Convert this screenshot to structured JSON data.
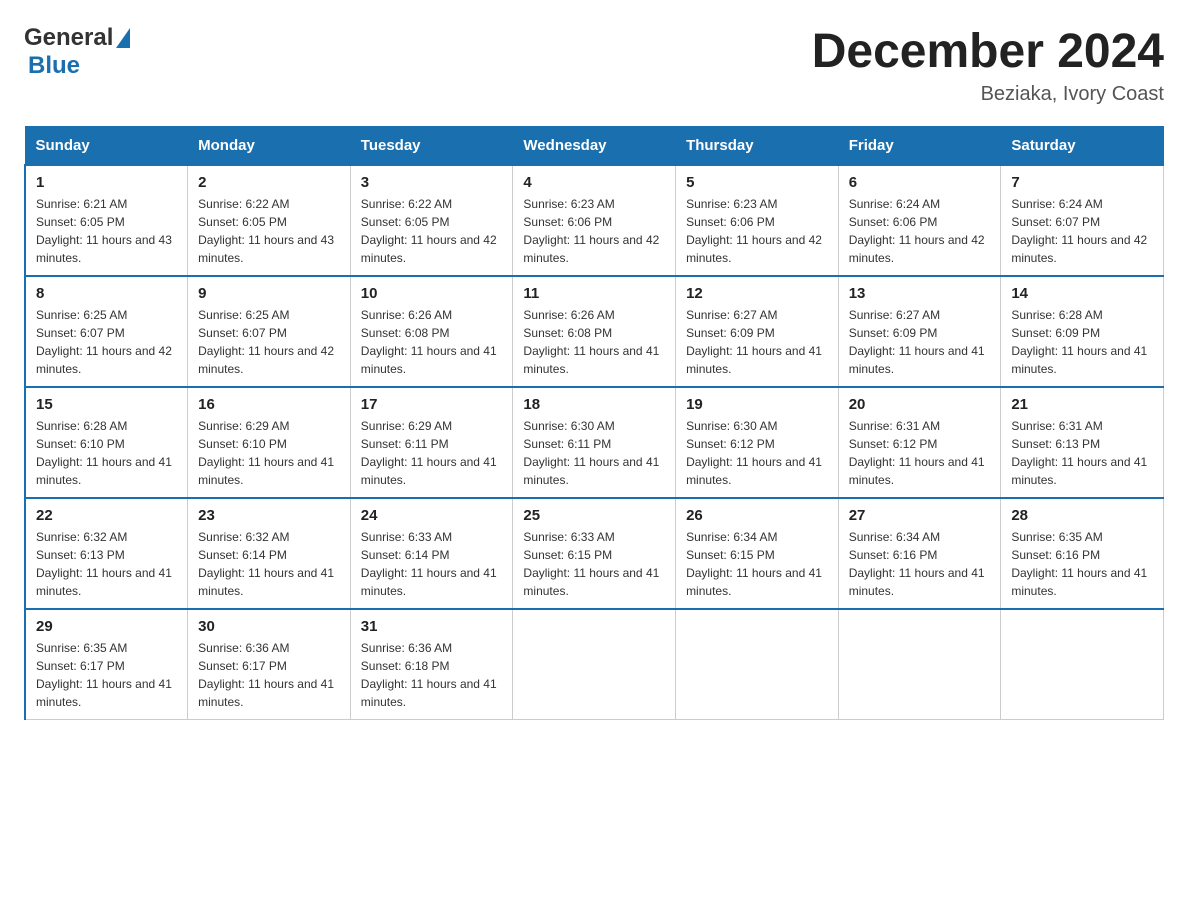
{
  "header": {
    "logo_general": "General",
    "logo_blue": "Blue",
    "month_title": "December 2024",
    "location": "Beziaka, Ivory Coast"
  },
  "days_of_week": [
    "Sunday",
    "Monday",
    "Tuesday",
    "Wednesday",
    "Thursday",
    "Friday",
    "Saturday"
  ],
  "weeks": [
    [
      {
        "day": "1",
        "sunrise": "6:21 AM",
        "sunset": "6:05 PM",
        "daylight": "11 hours and 43 minutes."
      },
      {
        "day": "2",
        "sunrise": "6:22 AM",
        "sunset": "6:05 PM",
        "daylight": "11 hours and 43 minutes."
      },
      {
        "day": "3",
        "sunrise": "6:22 AM",
        "sunset": "6:05 PM",
        "daylight": "11 hours and 42 minutes."
      },
      {
        "day": "4",
        "sunrise": "6:23 AM",
        "sunset": "6:06 PM",
        "daylight": "11 hours and 42 minutes."
      },
      {
        "day": "5",
        "sunrise": "6:23 AM",
        "sunset": "6:06 PM",
        "daylight": "11 hours and 42 minutes."
      },
      {
        "day": "6",
        "sunrise": "6:24 AM",
        "sunset": "6:06 PM",
        "daylight": "11 hours and 42 minutes."
      },
      {
        "day": "7",
        "sunrise": "6:24 AM",
        "sunset": "6:07 PM",
        "daylight": "11 hours and 42 minutes."
      }
    ],
    [
      {
        "day": "8",
        "sunrise": "6:25 AM",
        "sunset": "6:07 PM",
        "daylight": "11 hours and 42 minutes."
      },
      {
        "day": "9",
        "sunrise": "6:25 AM",
        "sunset": "6:07 PM",
        "daylight": "11 hours and 42 minutes."
      },
      {
        "day": "10",
        "sunrise": "6:26 AM",
        "sunset": "6:08 PM",
        "daylight": "11 hours and 41 minutes."
      },
      {
        "day": "11",
        "sunrise": "6:26 AM",
        "sunset": "6:08 PM",
        "daylight": "11 hours and 41 minutes."
      },
      {
        "day": "12",
        "sunrise": "6:27 AM",
        "sunset": "6:09 PM",
        "daylight": "11 hours and 41 minutes."
      },
      {
        "day": "13",
        "sunrise": "6:27 AM",
        "sunset": "6:09 PM",
        "daylight": "11 hours and 41 minutes."
      },
      {
        "day": "14",
        "sunrise": "6:28 AM",
        "sunset": "6:09 PM",
        "daylight": "11 hours and 41 minutes."
      }
    ],
    [
      {
        "day": "15",
        "sunrise": "6:28 AM",
        "sunset": "6:10 PM",
        "daylight": "11 hours and 41 minutes."
      },
      {
        "day": "16",
        "sunrise": "6:29 AM",
        "sunset": "6:10 PM",
        "daylight": "11 hours and 41 minutes."
      },
      {
        "day": "17",
        "sunrise": "6:29 AM",
        "sunset": "6:11 PM",
        "daylight": "11 hours and 41 minutes."
      },
      {
        "day": "18",
        "sunrise": "6:30 AM",
        "sunset": "6:11 PM",
        "daylight": "11 hours and 41 minutes."
      },
      {
        "day": "19",
        "sunrise": "6:30 AM",
        "sunset": "6:12 PM",
        "daylight": "11 hours and 41 minutes."
      },
      {
        "day": "20",
        "sunrise": "6:31 AM",
        "sunset": "6:12 PM",
        "daylight": "11 hours and 41 minutes."
      },
      {
        "day": "21",
        "sunrise": "6:31 AM",
        "sunset": "6:13 PM",
        "daylight": "11 hours and 41 minutes."
      }
    ],
    [
      {
        "day": "22",
        "sunrise": "6:32 AM",
        "sunset": "6:13 PM",
        "daylight": "11 hours and 41 minutes."
      },
      {
        "day": "23",
        "sunrise": "6:32 AM",
        "sunset": "6:14 PM",
        "daylight": "11 hours and 41 minutes."
      },
      {
        "day": "24",
        "sunrise": "6:33 AM",
        "sunset": "6:14 PM",
        "daylight": "11 hours and 41 minutes."
      },
      {
        "day": "25",
        "sunrise": "6:33 AM",
        "sunset": "6:15 PM",
        "daylight": "11 hours and 41 minutes."
      },
      {
        "day": "26",
        "sunrise": "6:34 AM",
        "sunset": "6:15 PM",
        "daylight": "11 hours and 41 minutes."
      },
      {
        "day": "27",
        "sunrise": "6:34 AM",
        "sunset": "6:16 PM",
        "daylight": "11 hours and 41 minutes."
      },
      {
        "day": "28",
        "sunrise": "6:35 AM",
        "sunset": "6:16 PM",
        "daylight": "11 hours and 41 minutes."
      }
    ],
    [
      {
        "day": "29",
        "sunrise": "6:35 AM",
        "sunset": "6:17 PM",
        "daylight": "11 hours and 41 minutes."
      },
      {
        "day": "30",
        "sunrise": "6:36 AM",
        "sunset": "6:17 PM",
        "daylight": "11 hours and 41 minutes."
      },
      {
        "day": "31",
        "sunrise": "6:36 AM",
        "sunset": "6:18 PM",
        "daylight": "11 hours and 41 minutes."
      },
      null,
      null,
      null,
      null
    ]
  ]
}
